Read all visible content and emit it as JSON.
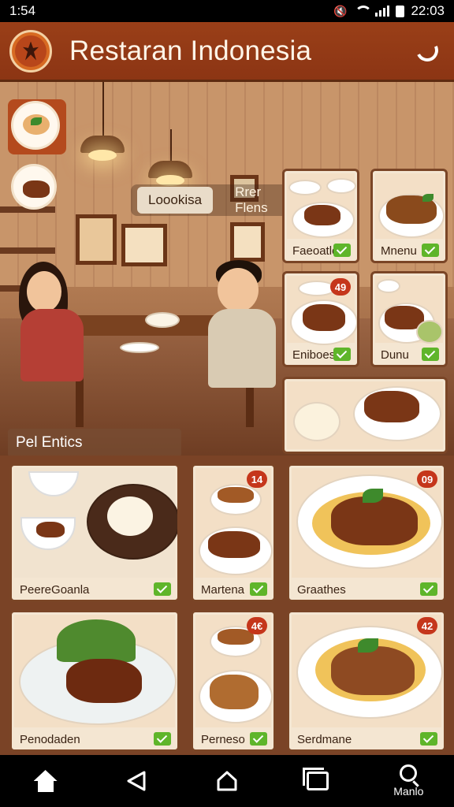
{
  "status": {
    "time": "1:54",
    "clock_right": "22:03"
  },
  "app": {
    "title": "Restaran Indonesia"
  },
  "filters": {
    "tab_active": "Loookisa",
    "tab_2": "Rrer Flens"
  },
  "hero": {
    "section_label": "Pel Entics"
  },
  "side_cards": [
    {
      "label": "Faeoatlo",
      "badge": ""
    },
    {
      "label": "Mnenu",
      "badge": ""
    },
    {
      "label": "Eniboes",
      "badge": "49"
    },
    {
      "label": "Dunu",
      "badge": ""
    },
    {
      "label": "",
      "badge": ""
    }
  ],
  "grid_cards": [
    {
      "label": "PeereGoanla",
      "badge": ""
    },
    {
      "label": "Martena",
      "badge": "14"
    },
    {
      "label": "Graathes",
      "badge": "09"
    },
    {
      "label": "Penodaden",
      "badge": ""
    },
    {
      "label": "Perneso",
      "badge": "4€"
    },
    {
      "label": "Serdmane",
      "badge": "42"
    }
  ],
  "nav": {
    "search_label": "Manlo"
  },
  "colors": {
    "header": "#8c3514",
    "accent_green": "#5fb52a",
    "badge_red": "#c5361b",
    "background": "#7a4326"
  }
}
